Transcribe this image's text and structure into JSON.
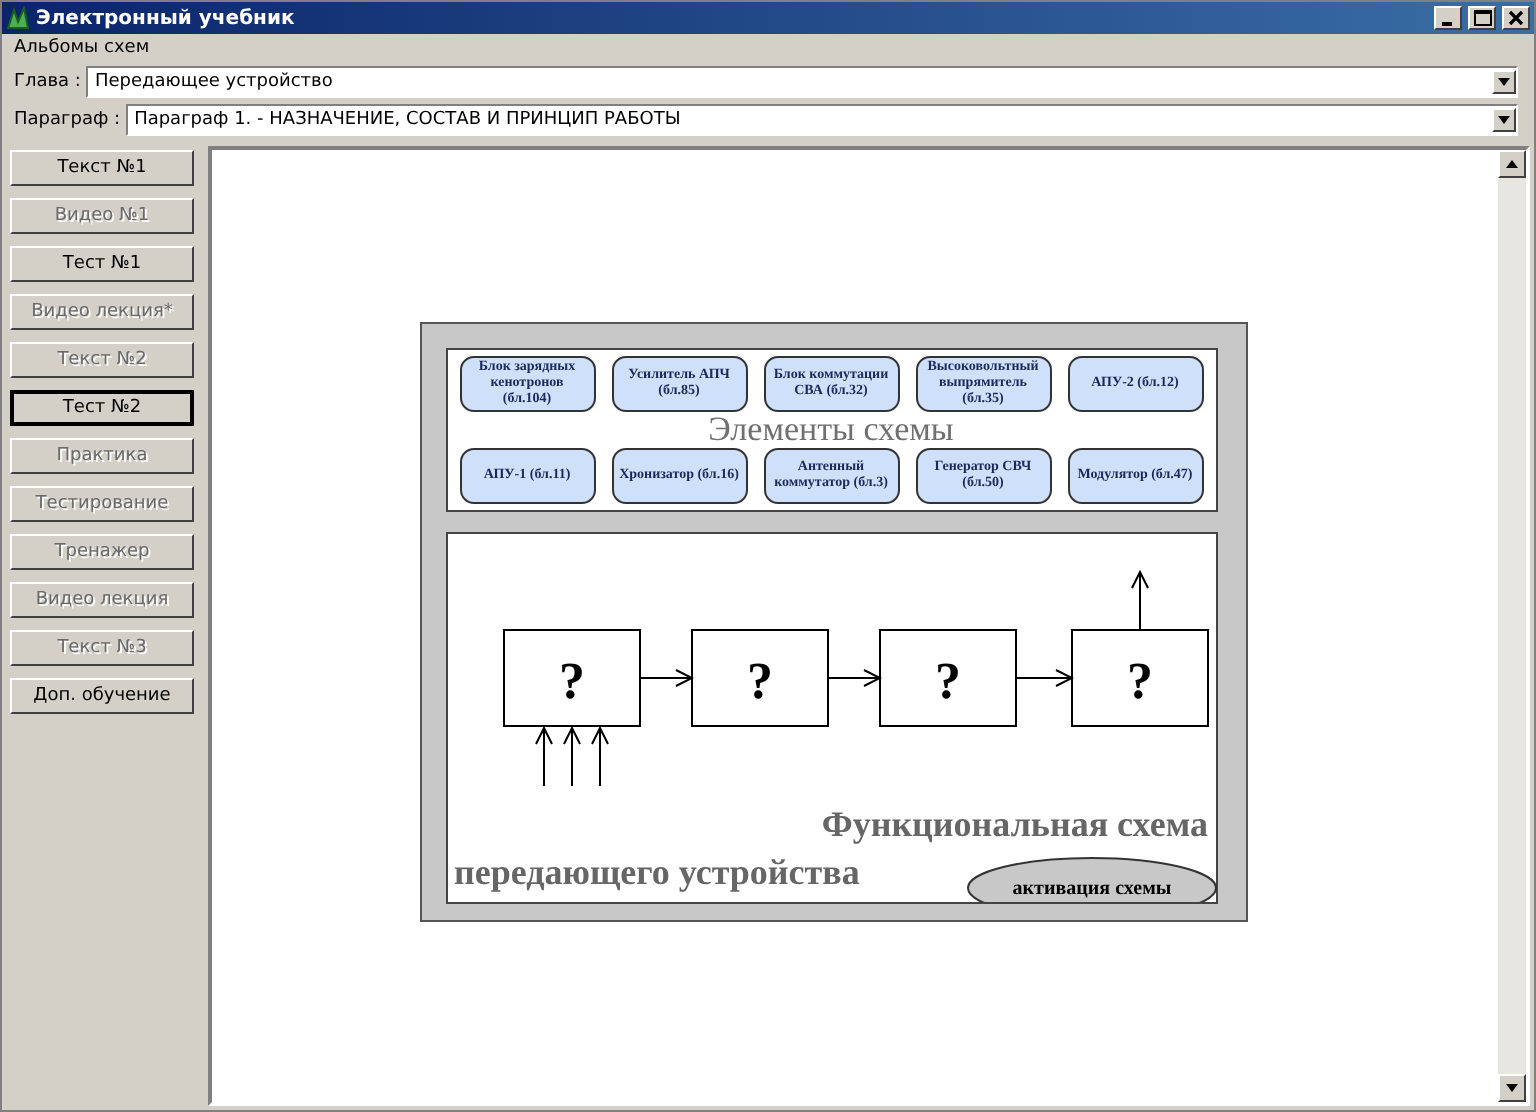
{
  "window": {
    "title": "Электронный учебник"
  },
  "menu": [
    "Альбомы схем"
  ],
  "fields": [
    {
      "label": "Глава :",
      "value": "Передающее устройство"
    },
    {
      "label": "Параграф :",
      "value": "Параграф 1. - НАЗНАЧЕНИЕ, СОСТАВ И ПРИНЦИП РАБОТЫ"
    }
  ],
  "sidebar": {
    "buttons": [
      {
        "label": "Текст №1",
        "disabled": false,
        "selected": false
      },
      {
        "label": "Видео №1",
        "disabled": true,
        "selected": false
      },
      {
        "label": "Тест №1",
        "disabled": false,
        "selected": false
      },
      {
        "label": "Видео лекция*",
        "disabled": true,
        "selected": false
      },
      {
        "label": "Текст №2",
        "disabled": true,
        "selected": false
      },
      {
        "label": "Тест №2",
        "disabled": false,
        "selected": true
      },
      {
        "label": "Практика",
        "disabled": true,
        "selected": false
      },
      {
        "label": "Тестирование",
        "disabled": true,
        "selected": false
      },
      {
        "label": "Тренажер",
        "disabled": true,
        "selected": false
      },
      {
        "label": "Видео лекция",
        "disabled": true,
        "selected": false
      },
      {
        "label": "Текст №3",
        "disabled": true,
        "selected": false
      },
      {
        "label": "Доп. обучение",
        "disabled": false,
        "selected": false
      }
    ]
  },
  "slide": {
    "heading": "Элементы схемы",
    "blocks": [
      "Блок зарядных кенотронов (бл.104)",
      "Усилитель АПЧ (бл.85)",
      "Блок коммутации СВА (бл.32)",
      "Высоковольтный выпрямитель (бл.35)",
      "АПУ-2 (бл.12)",
      "АПУ-1 (бл.11)",
      "Хронизатор (бл.16)",
      "Антенный коммутатор (бл.3)",
      "Генератор СВЧ (бл.50)",
      "Модулятор (бл.47)"
    ],
    "diagram": {
      "boxes": [
        "?",
        "?",
        "?",
        "?"
      ],
      "title_lines": [
        "Функциональная схема",
        "передающего устройства"
      ],
      "button": "активация схемы"
    }
  }
}
